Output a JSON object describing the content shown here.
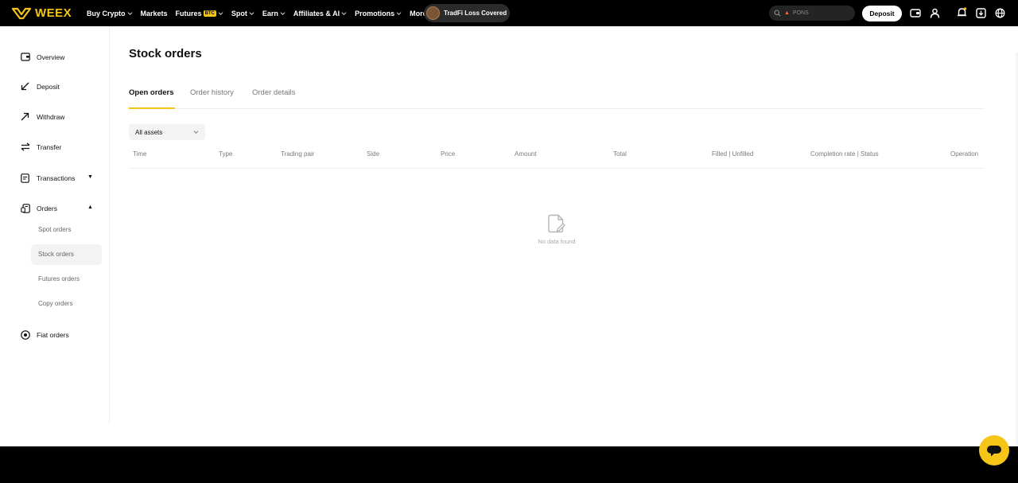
{
  "brand": {
    "name": "WEEX",
    "color": "#f5c518"
  },
  "nav": {
    "items": [
      {
        "label": "Buy Crypto",
        "chevron": true
      },
      {
        "label": "Markets",
        "chevron": false
      },
      {
        "label": "Futures",
        "badge": "BTC",
        "chevron": true
      },
      {
        "label": "Spot",
        "chevron": true
      },
      {
        "label": "Earn",
        "chevron": true
      },
      {
        "label": "Affiliates & AI",
        "chevron": true
      },
      {
        "label": "Promotions",
        "chevron": true
      },
      {
        "label": "More",
        "chevron": true
      }
    ],
    "promo": "TradFi Loss Covered"
  },
  "header": {
    "search_placeholder": "PONS",
    "deposit_label": "Deposit",
    "icons": [
      "wallet-icon",
      "user-icon",
      "bell-icon",
      "download-icon",
      "globe-icon"
    ]
  },
  "sidebar": {
    "items": [
      {
        "label": "Overview",
        "icon": "wallet-icon"
      },
      {
        "label": "Deposit",
        "icon": "arrow-down-left-icon"
      },
      {
        "label": "Withdraw",
        "icon": "arrow-up-right-icon"
      },
      {
        "label": "Transfer",
        "icon": "transfer-icon"
      },
      {
        "label": "Transactions",
        "icon": "document-icon"
      },
      {
        "label": "Orders",
        "icon": "orders-icon"
      },
      {
        "label": "Fiat orders",
        "icon": "fiat-icon"
      }
    ],
    "orders_sub": [
      {
        "label": "Spot orders"
      },
      {
        "label": "Stock orders",
        "active": true
      },
      {
        "label": "Futures orders"
      },
      {
        "label": "Copy orders"
      }
    ]
  },
  "main": {
    "title": "Stock orders",
    "tabs": [
      {
        "label": "Open orders",
        "active": true
      },
      {
        "label": "Order history"
      },
      {
        "label": "Order details"
      }
    ],
    "filter": {
      "selected": "All assets"
    },
    "columns": [
      "Time",
      "Type",
      "Trading pair",
      "Side",
      "Price",
      "Amount",
      "Total",
      "Filled | Unfilled",
      "Completion rate | Status",
      "Operation"
    ],
    "empty_text": "No data found"
  }
}
